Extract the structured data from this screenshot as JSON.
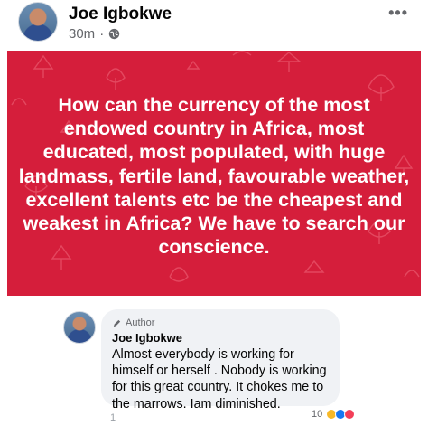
{
  "post": {
    "author": "Joe Igbokwe",
    "time": "30m",
    "privacy_icon": "globe-icon",
    "more_label": "•••",
    "banner": {
      "background_color": "#d51e3b",
      "text": "How can the currency of the most endowed country in Africa, most educated, most populated, with huge landmass, fertile land, favourable weather, excellent talents etc be the cheapest and weakest in Africa? We have to search our conscience."
    }
  },
  "comment": {
    "badge": "Author",
    "author": "Joe Igbokwe",
    "text": "Almost everybody is working for himself or herself . Nobody is working for this great country. It chokes me to the marrows. Iam diminished.",
    "reaction_count": "10",
    "actions_partial": "1"
  }
}
